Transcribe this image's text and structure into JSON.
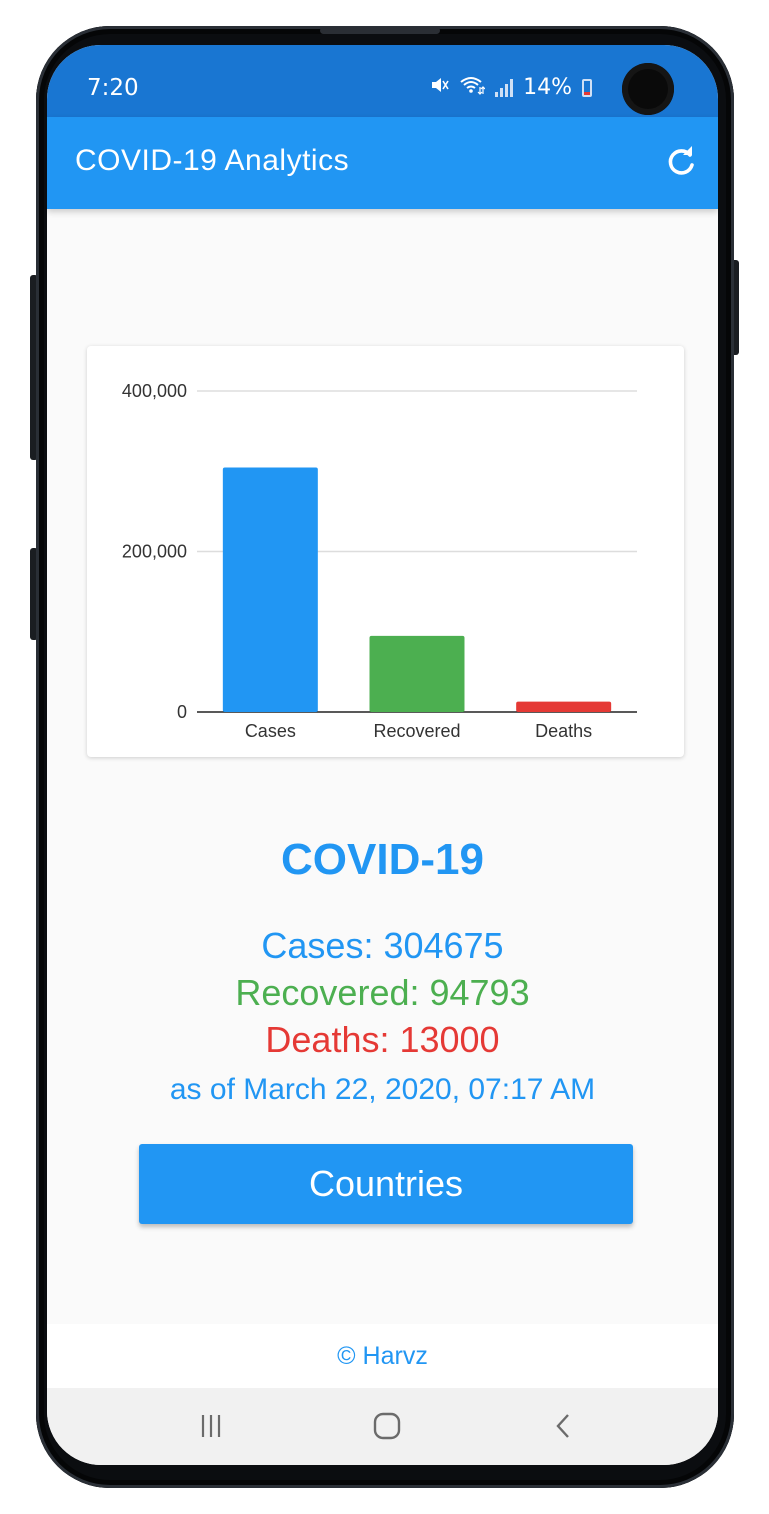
{
  "status_bar": {
    "time": "7:20",
    "battery_text": "14%",
    "icons": [
      "mute-icon",
      "wifi-icon",
      "signal-icon",
      "battery-icon"
    ]
  },
  "app_bar": {
    "title": "COVID-19 Analytics",
    "action_icon": "refresh-icon"
  },
  "chart_data": {
    "type": "bar",
    "categories": [
      "Cases",
      "Recovered",
      "Deaths"
    ],
    "values": [
      304675,
      94793,
      13000
    ],
    "colors": [
      "#2196f3",
      "#4caf50",
      "#e53935"
    ],
    "yticks": [
      "0",
      "200,000",
      "400,000"
    ],
    "ytick_values": [
      0,
      200000,
      400000
    ],
    "ylim": [
      0,
      400000
    ],
    "grid": true,
    "title": "",
    "xlabel": "",
    "ylabel": ""
  },
  "summary": {
    "title": "COVID-19",
    "cases": "Cases: 304675",
    "recovered": "Recovered: 94793",
    "deaths": "Deaths: 13000",
    "as_of": "as of March 22, 2020, 07:17 AM"
  },
  "countries_button": {
    "label": "Countries"
  },
  "footer": {
    "text": "© Harvz"
  },
  "nav_bar": {
    "icons": [
      "recents-icon",
      "home-icon",
      "back-icon"
    ]
  },
  "colors": {
    "primary": "#2196f3",
    "status_bar": "#1976d2",
    "recovered": "#4caf50",
    "deaths": "#e53935"
  }
}
